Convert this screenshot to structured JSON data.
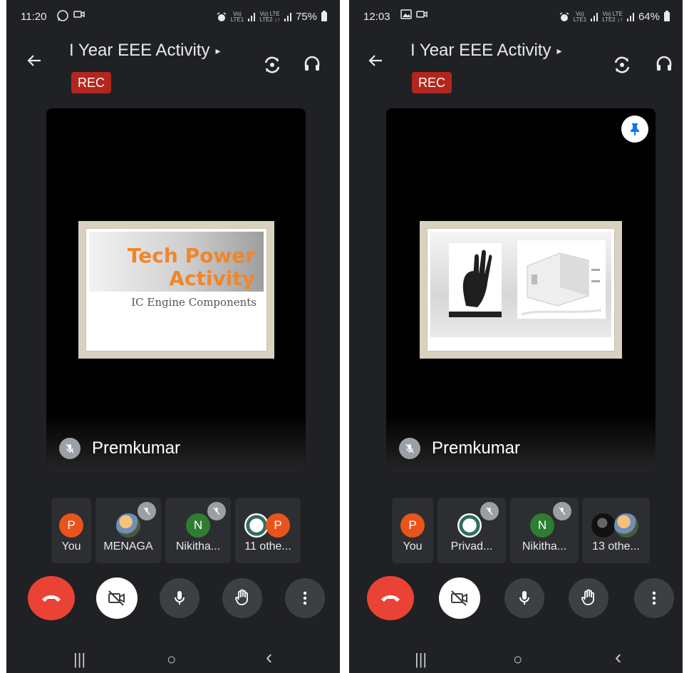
{
  "phones": [
    {
      "status_time": "11:20",
      "status_app_icons": [
        "whatsapp-icon",
        "video-icon"
      ],
      "battery": "75%",
      "title": "I Year EEE Activity",
      "title_caret": "▸",
      "rec": "REC",
      "presenter": "Premkumar",
      "slide": {
        "title_line1": "Tech Power",
        "title_line2": "Activity",
        "subtitle": "IC Engine Components"
      },
      "participants": [
        "You",
        "MENAGA",
        "Nikitha...",
        "11 othe..."
      ],
      "avatar_letters": {
        "you": "P",
        "nikitha": "N",
        "others": "P"
      }
    },
    {
      "status_time": "12:03",
      "status_app_icons": [
        "gallery-icon",
        "video-icon"
      ],
      "battery": "64%",
      "title": "I Year EEE Activity",
      "title_caret": "▸",
      "rec": "REC",
      "presenter": "Premkumar",
      "participants": [
        "You",
        "Privad...",
        "Nikitha...",
        "13 othe..."
      ],
      "avatar_letters": {
        "you": "P",
        "nikitha": "N"
      }
    }
  ],
  "navbar": {
    "recents": "|||",
    "home": "○",
    "back": "‹"
  },
  "colors": {
    "background": "#202124",
    "end_call": "#ea4335",
    "rec": "#b3261e",
    "avatar_orange": "#e8541c",
    "avatar_green": "#2e7d32"
  }
}
